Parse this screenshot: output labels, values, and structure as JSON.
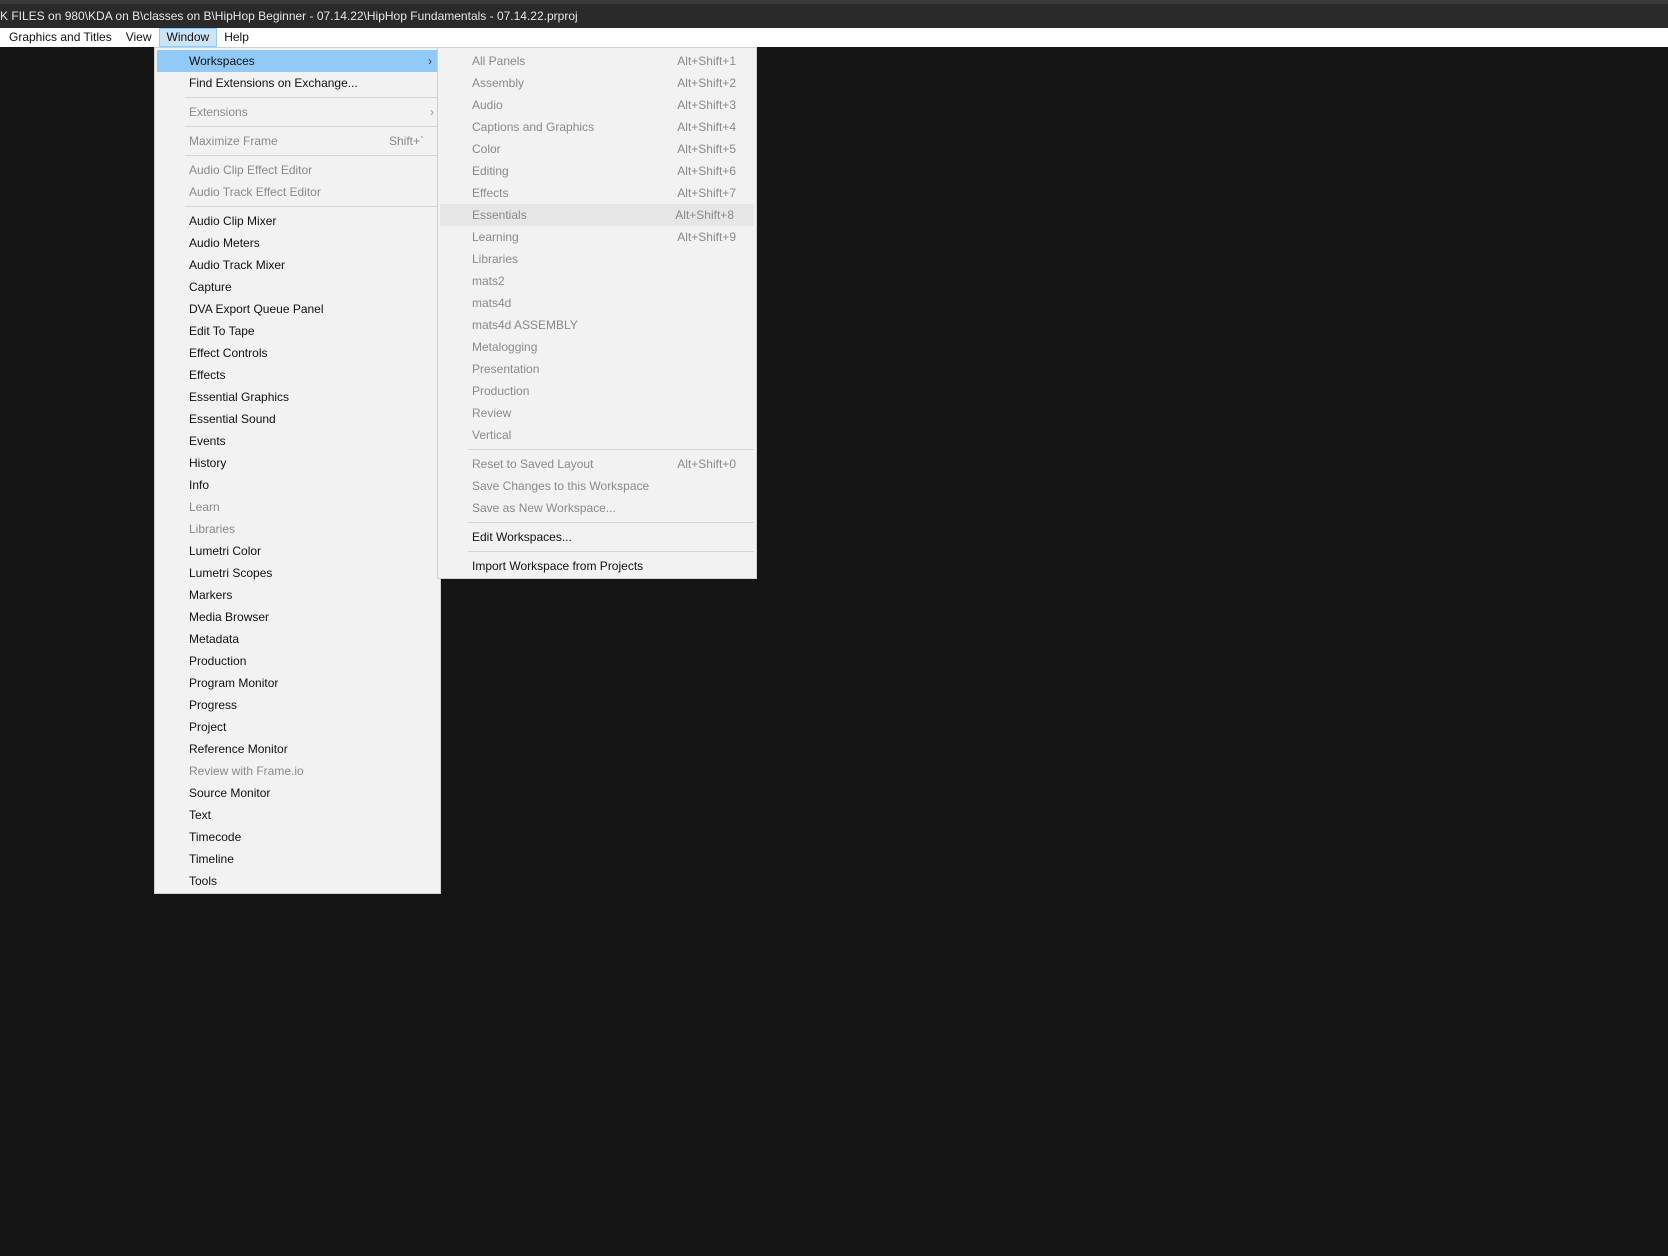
{
  "title_bar": {
    "text": "K FILES on 980\\KDA on B\\classes on B\\HipHop Beginner - 07.14.22\\HipHop Fundamentals - 07.14.22.prproj"
  },
  "menubar": {
    "items": [
      "Graphics and Titles",
      "View",
      "Window",
      "Help"
    ],
    "active": "Window"
  },
  "window_menu": {
    "workspaces": "Workspaces",
    "find_extensions": "Find Extensions on Exchange...",
    "extensions": "Extensions",
    "maximize_frame": "Maximize Frame",
    "maximize_frame_shortcut": "Shift+`",
    "audio_clip_effect_editor": "Audio Clip Effect Editor",
    "audio_track_effect_editor": "Audio Track Effect Editor",
    "panels": [
      {
        "label": "Audio Clip Mixer",
        "enabled": true
      },
      {
        "label": "Audio Meters",
        "enabled": true
      },
      {
        "label": "Audio Track Mixer",
        "enabled": true
      },
      {
        "label": "Capture",
        "enabled": true
      },
      {
        "label": "DVA Export Queue Panel",
        "enabled": true
      },
      {
        "label": "Edit To Tape",
        "enabled": true
      },
      {
        "label": "Effect Controls",
        "enabled": true
      },
      {
        "label": "Effects",
        "enabled": true
      },
      {
        "label": "Essential Graphics",
        "enabled": true
      },
      {
        "label": "Essential Sound",
        "enabled": true
      },
      {
        "label": "Events",
        "enabled": true
      },
      {
        "label": "History",
        "enabled": true
      },
      {
        "label": "Info",
        "enabled": true
      },
      {
        "label": "Learn",
        "enabled": false
      },
      {
        "label": "Libraries",
        "enabled": false
      },
      {
        "label": "Lumetri Color",
        "enabled": true
      },
      {
        "label": "Lumetri Scopes",
        "enabled": true
      },
      {
        "label": "Markers",
        "enabled": true
      },
      {
        "label": "Media Browser",
        "enabled": true
      },
      {
        "label": "Metadata",
        "enabled": true
      },
      {
        "label": "Production",
        "enabled": true
      },
      {
        "label": "Program Monitor",
        "enabled": true
      },
      {
        "label": "Progress",
        "enabled": true
      },
      {
        "label": "Project",
        "enabled": true
      },
      {
        "label": "Reference Monitor",
        "enabled": true
      },
      {
        "label": "Review with Frame.io",
        "enabled": false
      },
      {
        "label": "Source Monitor",
        "enabled": true
      },
      {
        "label": "Text",
        "enabled": true
      },
      {
        "label": "Timecode",
        "enabled": true
      },
      {
        "label": "Timeline",
        "enabled": true
      },
      {
        "label": "Tools",
        "enabled": true
      }
    ]
  },
  "workspaces_menu": {
    "workspaces": [
      {
        "label": "All Panels",
        "shortcut": "Alt+Shift+1"
      },
      {
        "label": "Assembly",
        "shortcut": "Alt+Shift+2"
      },
      {
        "label": "Audio",
        "shortcut": "Alt+Shift+3"
      },
      {
        "label": "Captions and Graphics",
        "shortcut": "Alt+Shift+4"
      },
      {
        "label": "Color",
        "shortcut": "Alt+Shift+5"
      },
      {
        "label": "Editing",
        "shortcut": "Alt+Shift+6"
      },
      {
        "label": "Effects",
        "shortcut": "Alt+Shift+7"
      },
      {
        "label": "Essentials",
        "shortcut": "Alt+Shift+8"
      },
      {
        "label": "Learning",
        "shortcut": "Alt+Shift+9"
      },
      {
        "label": "Libraries",
        "shortcut": ""
      },
      {
        "label": "mats2",
        "shortcut": ""
      },
      {
        "label": "mats4d",
        "shortcut": ""
      },
      {
        "label": "mats4d ASSEMBLY",
        "shortcut": ""
      },
      {
        "label": "Metalogging",
        "shortcut": ""
      },
      {
        "label": "Presentation",
        "shortcut": ""
      },
      {
        "label": "Production",
        "shortcut": ""
      },
      {
        "label": "Review",
        "shortcut": ""
      },
      {
        "label": "Vertical",
        "shortcut": ""
      }
    ],
    "hovered": "Essentials",
    "reset_layout": "Reset to Saved Layout",
    "reset_layout_shortcut": "Alt+Shift+0",
    "save_changes": "Save Changes to this Workspace",
    "save_new": "Save as New Workspace...",
    "edit_workspaces": "Edit Workspaces...",
    "import_workspace": "Import Workspace from Projects"
  }
}
